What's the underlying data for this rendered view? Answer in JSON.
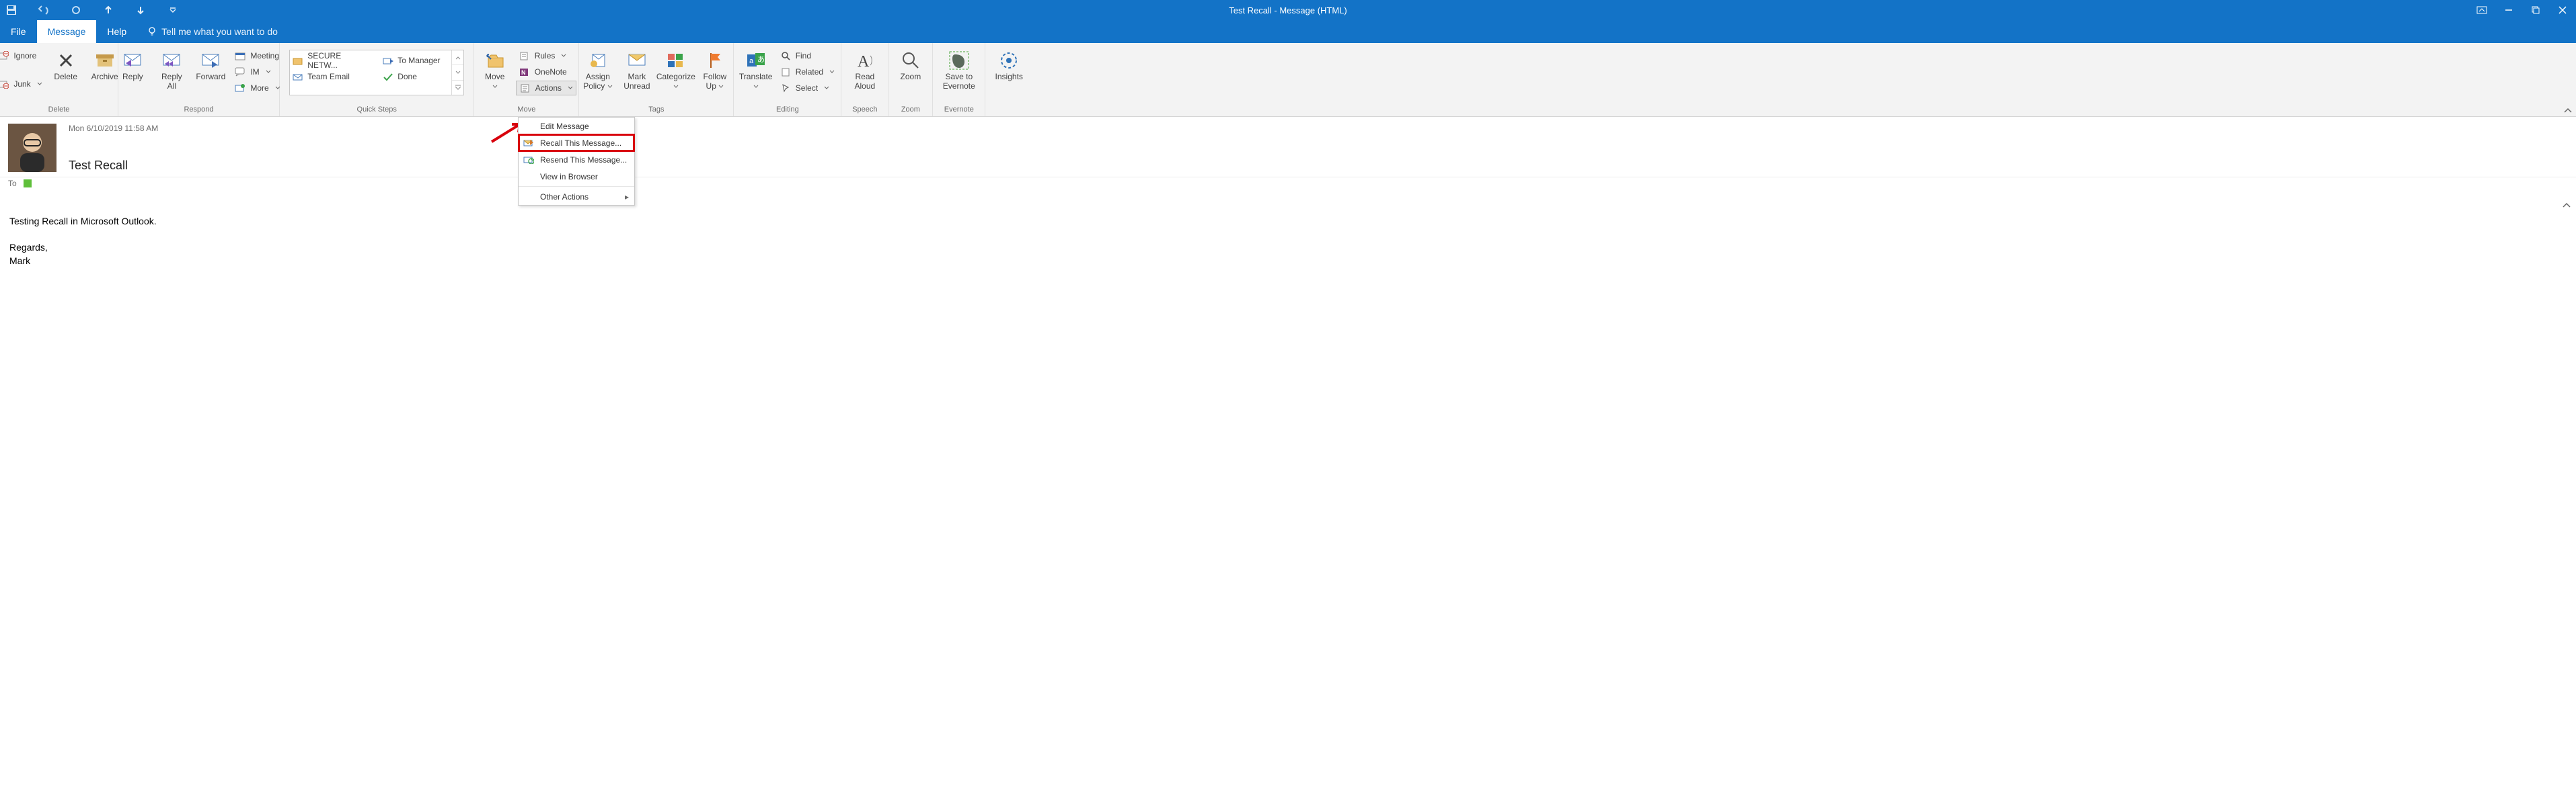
{
  "window": {
    "title": "Test Recall   -  Message (HTML)"
  },
  "tabs": {
    "file": "File",
    "message": "Message",
    "help": "Help",
    "tellme": "Tell me what you want to do"
  },
  "ribbon": {
    "delete": {
      "ignore": "Ignore",
      "junk": "Junk",
      "delete": "Delete",
      "archive": "Archive",
      "group": "Delete"
    },
    "respond": {
      "reply": "Reply",
      "replyall_l1": "Reply",
      "replyall_l2": "All",
      "forward": "Forward",
      "meeting": "Meeting",
      "im": "IM",
      "more": "More",
      "group": "Respond"
    },
    "quicksteps": {
      "secure": "SECURE NETW...",
      "team": "Team Email",
      "tomgr": "To Manager",
      "done": "Done",
      "group": "Quick Steps"
    },
    "move": {
      "move": "Move",
      "rules": "Rules",
      "onenote": "OneNote",
      "actions": "Actions",
      "group": "Move"
    },
    "tags": {
      "assign_l1": "Assign",
      "assign_l2": "Policy",
      "mark_l1": "Mark",
      "mark_l2": "Unread",
      "categorize": "Categorize",
      "follow_l1": "Follow",
      "follow_l2": "Up",
      "group": "Tags"
    },
    "editing": {
      "translate": "Translate",
      "find": "Find",
      "related": "Related",
      "select": "Select",
      "group": "Editing"
    },
    "speech": {
      "read_l1": "Read",
      "read_l2": "Aloud",
      "group": "Speech"
    },
    "zoom": {
      "zoom": "Zoom",
      "group": "Zoom"
    },
    "evernote": {
      "save_l1": "Save to",
      "save_l2": "Evernote",
      "group": "Evernote"
    },
    "insights": {
      "insights": "Insights"
    }
  },
  "actions_menu": {
    "edit": "Edit Message",
    "recall": "Recall This Message...",
    "resend": "Resend This Message...",
    "view": "View in Browser",
    "other": "Other Actions"
  },
  "message": {
    "date": "Mon 6/10/2019 11:58 AM",
    "subject": "Test Recall",
    "to_label": "To",
    "body_l1": "Testing Recall in Microsoft Outlook.",
    "body_l2": "Regards,",
    "body_l3": "Mark"
  }
}
